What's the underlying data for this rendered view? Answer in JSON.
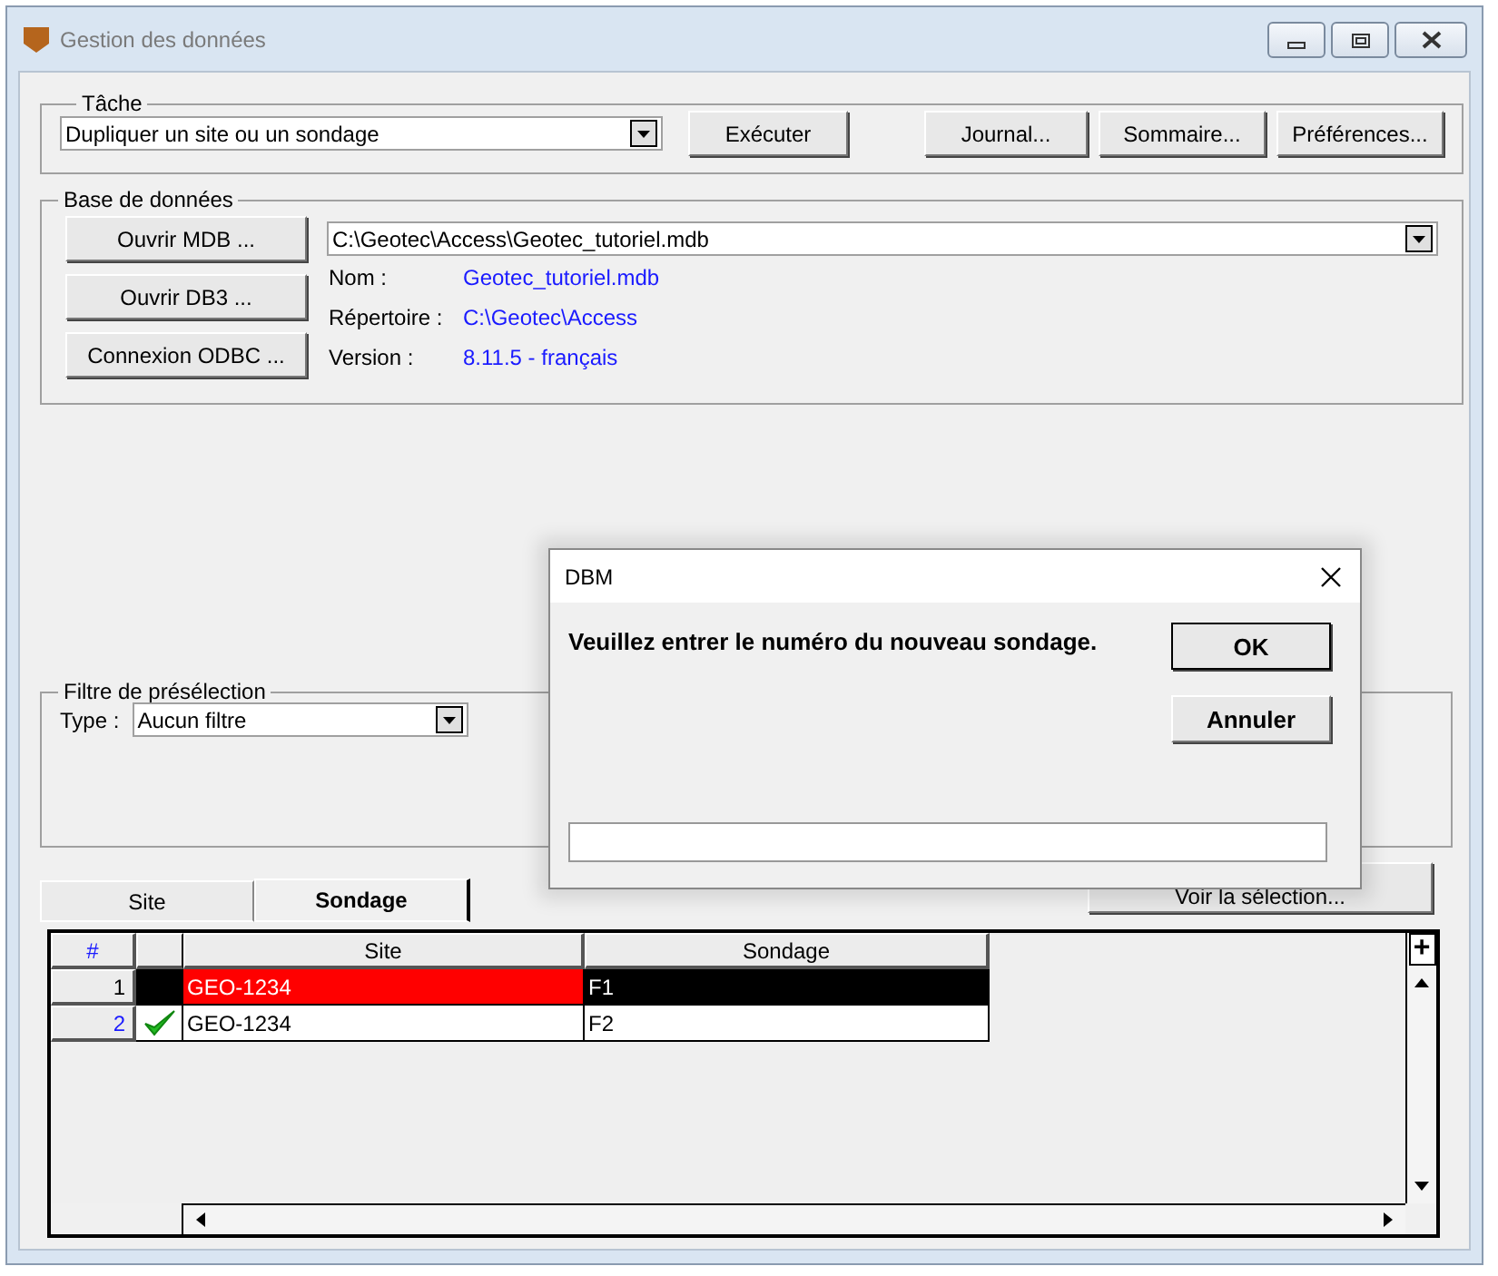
{
  "window": {
    "title": "Gestion des données"
  },
  "task": {
    "label": "Tâche",
    "value": "Dupliquer un site ou un sondage",
    "buttons": [
      "Exécuter",
      "Journal...",
      "Sommaire...",
      "Préférences..."
    ]
  },
  "database": {
    "label": "Base de données",
    "buttons": [
      "Ouvrir MDB ...",
      "Ouvrir DB3 ...",
      "Connexion ODBC ..."
    ],
    "path": "C:\\Geotec\\Access\\Geotec_tutoriel.mdb",
    "info": [
      {
        "label": "Nom :",
        "value": "Geotec_tutoriel.mdb"
      },
      {
        "label": "Répertoire :",
        "value": "C:\\Geotec\\Access"
      },
      {
        "label": "Version :",
        "value": "8.11.5 - français"
      }
    ]
  },
  "filter": {
    "label": "Filtre de présélection",
    "type_label": "Type :",
    "value": "Aucun filtre"
  },
  "tabs": [
    {
      "label": "Site",
      "selected": false
    },
    {
      "label": "Sondage",
      "selected": true
    }
  ],
  "selection_button": "Voir la sélection...",
  "grid": {
    "columns": [
      "#",
      "Site",
      "Sondage"
    ],
    "rows": [
      {
        "number": "1",
        "site": "GEO-1234",
        "sondage": "F1",
        "checked": false,
        "selected": true
      },
      {
        "number": "2",
        "site": "GEO-1234",
        "sondage": "F2",
        "checked": true,
        "selected": false
      }
    ],
    "add_button": "+"
  },
  "dialog": {
    "title": "DBM",
    "message": "Veuillez entrer le numéro du nouveau sondage.",
    "buttons": [
      "OK",
      "Annuler"
    ]
  }
}
